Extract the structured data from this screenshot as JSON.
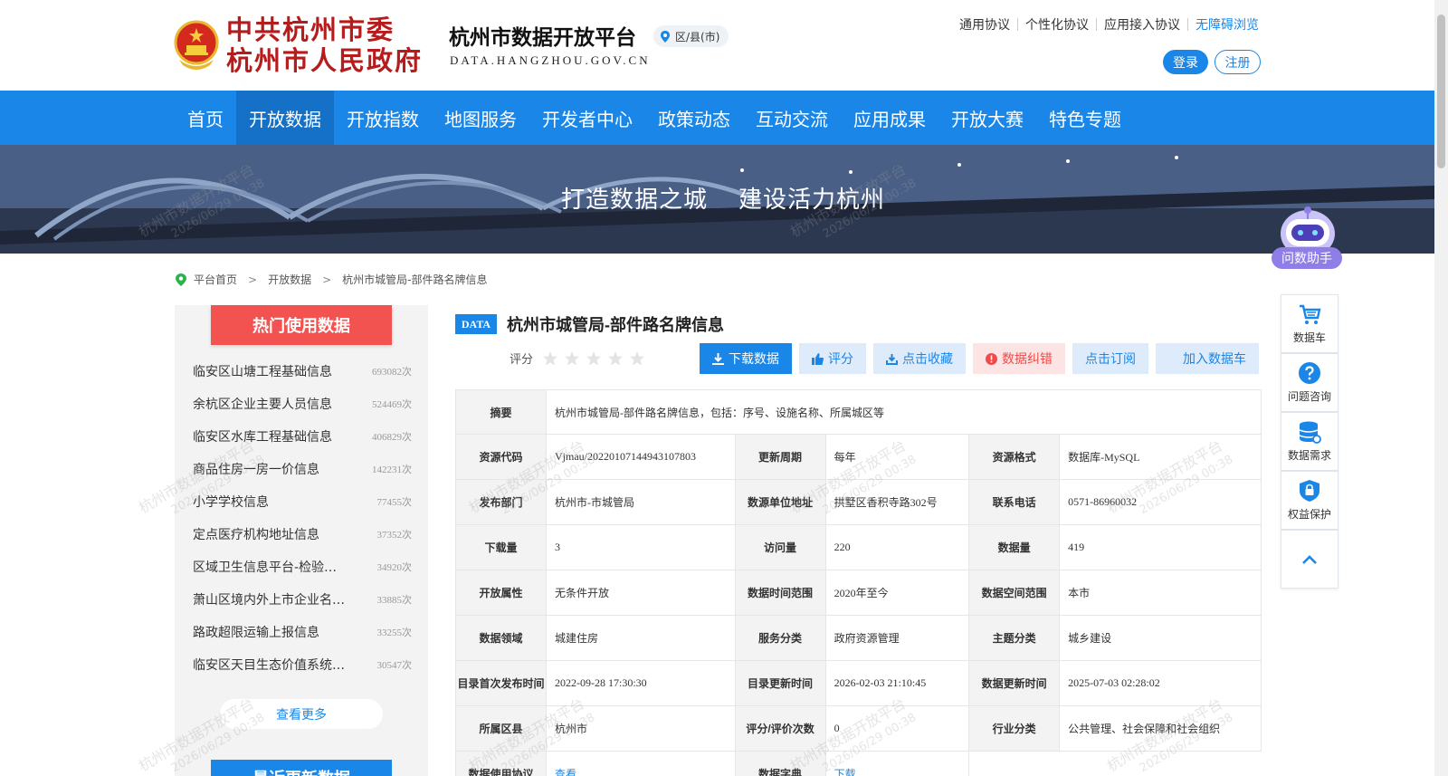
{
  "header": {
    "gov_name_line1": "中共杭州市委",
    "gov_name_line2": "杭州市人民政府",
    "platform_name": "杭州市数据开放平台",
    "platform_url": "DATA.HANGZHOU.GOV.CN",
    "district_label": "区/县(市)",
    "links": [
      "通用协议",
      "个性化协议",
      "应用接入协议",
      "无障碍浏览"
    ],
    "login": "登录",
    "register": "注册"
  },
  "nav": [
    "首页",
    "开放数据",
    "开放指数",
    "地图服务",
    "开发者中心",
    "政策动态",
    "互动交流",
    "应用成果",
    "开放大赛",
    "特色专题"
  ],
  "banner": {
    "slogan1": "打造数据之城",
    "slogan2": "建设活力杭州"
  },
  "assistant": {
    "label": "问数助手"
  },
  "breadcrumb": [
    "平台首页",
    "开放数据",
    "杭州市城管局-部件路名牌信息"
  ],
  "hot": {
    "title": "热门使用数据",
    "items": [
      {
        "name": "临安区山塘工程基础信息",
        "count": "693082次"
      },
      {
        "name": "余杭区企业主要人员信息",
        "count": "524469次"
      },
      {
        "name": "临安区水库工程基础信息",
        "count": "406829次"
      },
      {
        "name": "商品住房一房一价信息",
        "count": "142231次"
      },
      {
        "name": "小学学校信息",
        "count": "77455次"
      },
      {
        "name": "定点医疗机构地址信息",
        "count": "37352次"
      },
      {
        "name": "区域卫生信息平台-检验…",
        "count": "34920次"
      },
      {
        "name": "萧山区境内外上市企业名…",
        "count": "33885次"
      },
      {
        "name": "路政超限运输上报信息",
        "count": "33255次"
      },
      {
        "name": "临安区天目生态价值系统…",
        "count": "30547次"
      }
    ],
    "more": "查看更多"
  },
  "recent_title": "最近更新数据",
  "dataset": {
    "tag": "DATA",
    "title": "杭州市城管局-部件路名牌信息",
    "rating_label": "评分",
    "rating_value": 0,
    "actions": [
      "下载数据",
      "评分",
      "点击收藏",
      "数据纠错",
      "点击订阅",
      "加入数据车"
    ],
    "summary_label": "摘要",
    "summary": "杭州市城管局-部件路名牌信息，包括：序号、设施名称、所属城区等",
    "rows": [
      [
        {
          "k": "资源代码",
          "v": "Vjmau/20220107144943107803"
        },
        {
          "k": "更新周期",
          "v": "每年"
        },
        {
          "k": "资源格式",
          "v": "数据库-MySQL"
        }
      ],
      [
        {
          "k": "发布部门",
          "v": "杭州市-市城管局"
        },
        {
          "k": "数源单位地址",
          "v": "拱墅区香积寺路302号"
        },
        {
          "k": "联系电话",
          "v": "0571-86960032"
        }
      ],
      [
        {
          "k": "下载量",
          "v": "3"
        },
        {
          "k": "访问量",
          "v": "220"
        },
        {
          "k": "数据量",
          "v": "419"
        }
      ],
      [
        {
          "k": "开放属性",
          "v": "无条件开放"
        },
        {
          "k": "数据时间范围",
          "v": "2020年至今"
        },
        {
          "k": "数据空间范围",
          "v": "本市"
        }
      ],
      [
        {
          "k": "数据领域",
          "v": "城建住房"
        },
        {
          "k": "服务分类",
          "v": "政府资源管理"
        },
        {
          "k": "主题分类",
          "v": "城乡建设"
        }
      ],
      [
        {
          "k": "目录首次发布时间",
          "v": "2022-09-28 17:30:30"
        },
        {
          "k": "目录更新时间",
          "v": "2026-02-03 21:10:45"
        },
        {
          "k": "数据更新时间",
          "v": "2025-07-03 02:28:02"
        }
      ],
      [
        {
          "k": "所属区县",
          "v": "杭州市"
        },
        {
          "k": "评分/评价次数",
          "v": "0"
        },
        {
          "k": "行业分类",
          "v": "公共管理、社会保障和社会组织"
        }
      ],
      [
        {
          "k": "数据使用协议",
          "v": "查看"
        },
        {
          "k": "数据字典",
          "v": "下载"
        }
      ]
    ]
  },
  "tools": [
    "数据车",
    "问题咨询",
    "数据需求",
    "权益保护"
  ],
  "watermark": {
    "line1": "杭州市数据开放平台",
    "line2": "2026/06/29 00:38"
  }
}
